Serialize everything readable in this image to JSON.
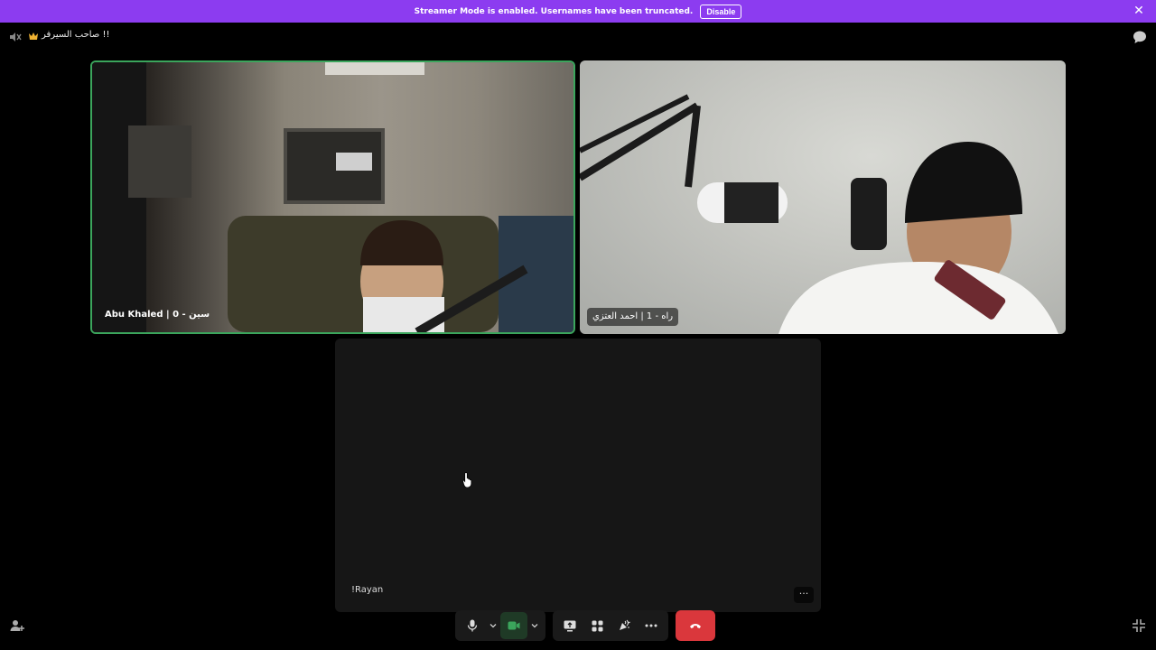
{
  "banner": {
    "message": "Streamer Mode is enabled. Usernames have been truncated.",
    "disable_label": "Disable",
    "close_icon": "close-icon",
    "color": "#8c3cf0"
  },
  "header": {
    "channel_name": "صاحب السيرفر !!",
    "icons": [
      "volume-icon",
      "crown-icon",
      "chat-icon"
    ]
  },
  "tiles": [
    {
      "name": "Abu Khaled | 0 - سين",
      "speaking": true,
      "speaking_color": "#3ba55c"
    },
    {
      "name": "راه - 1 | احمد العتزي"
    },
    {
      "name": "!Rayan",
      "menu_label": "···"
    }
  ],
  "controls": {
    "icons": [
      "microphone-icon",
      "chevron-down-icon",
      "camera-icon",
      "chevron-down-icon",
      "screen-share-icon",
      "activities-icon",
      "soundboard-icon",
      "more-icon",
      "hang-up-icon"
    ],
    "camera_color": "#3ba55c",
    "hangup_color": "#da373c"
  },
  "corners": {
    "left_icon": "invite-icon",
    "right_icon": "exit-fullscreen-icon"
  }
}
